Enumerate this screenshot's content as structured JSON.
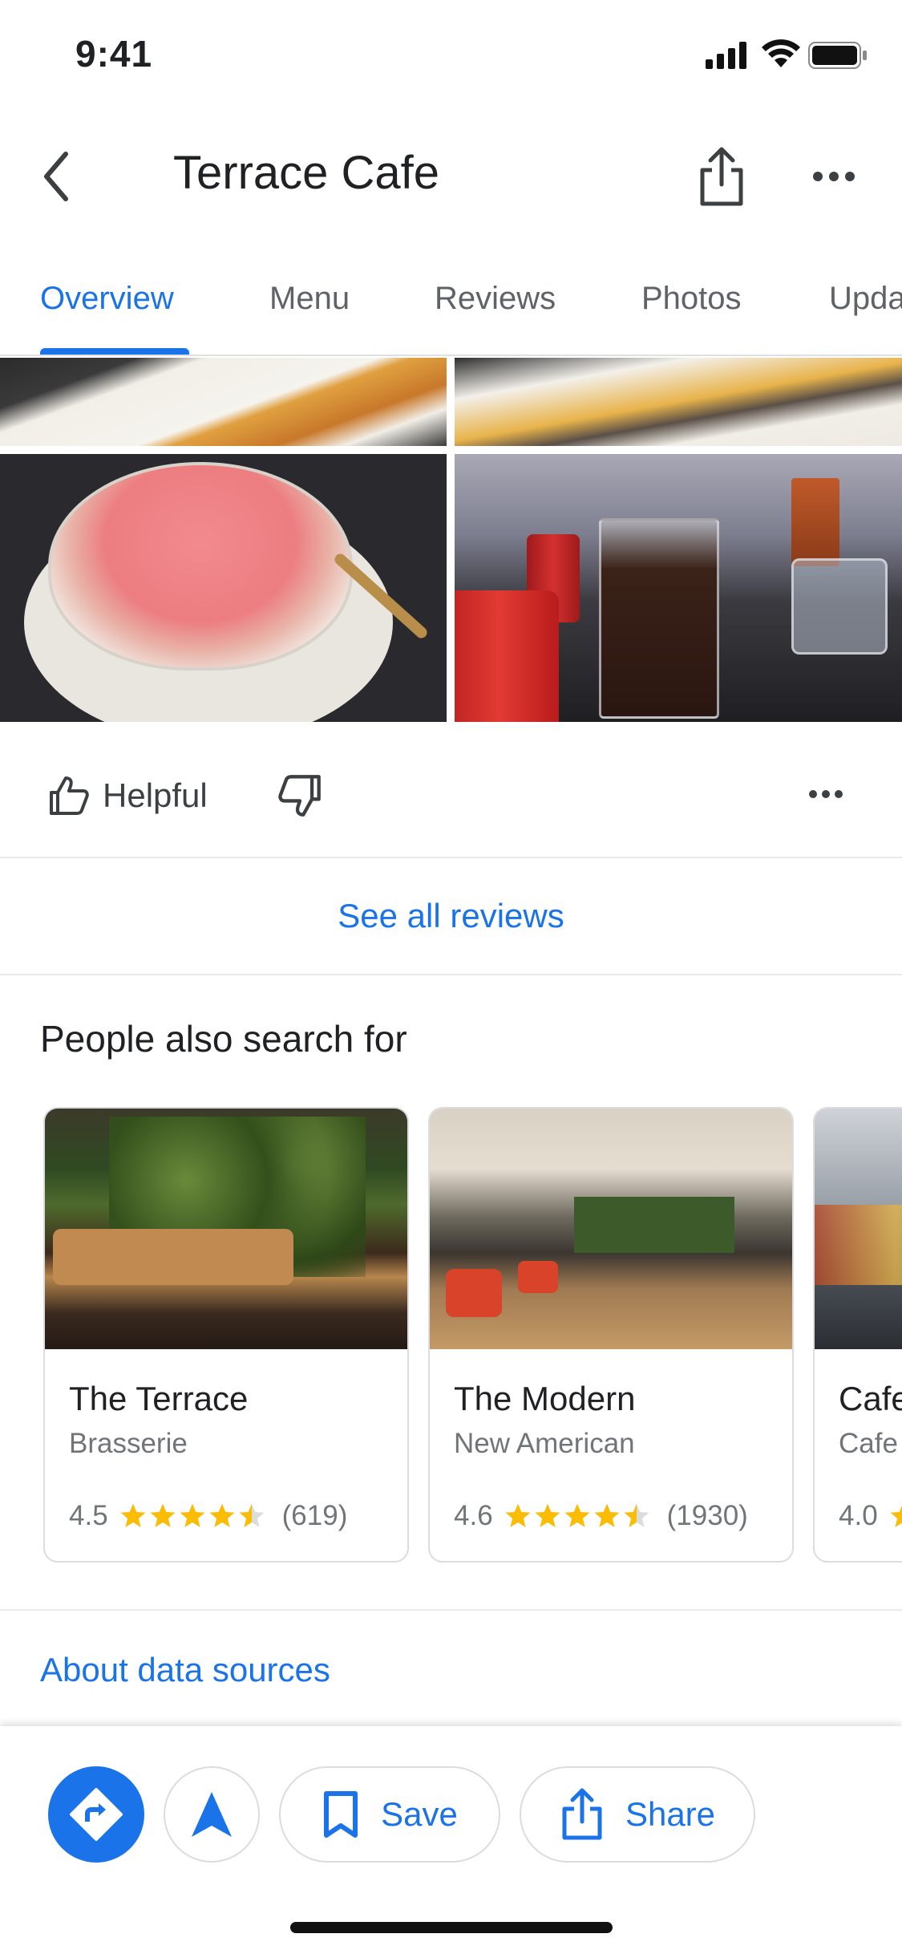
{
  "status_bar": {
    "time": "9:41"
  },
  "header": {
    "title": "Terrace Cafe"
  },
  "tabs": [
    {
      "label": "Overview"
    },
    {
      "label": "Menu"
    },
    {
      "label": "Reviews"
    },
    {
      "label": "Photos"
    },
    {
      "label": "Updates"
    }
  ],
  "review_actions": {
    "helpful_label": "Helpful"
  },
  "see_all_reviews": "See all reviews",
  "people_also_search": {
    "title": "People also search for",
    "places": [
      {
        "name": "The Terrace",
        "category": "Brasserie",
        "rating": "4.5",
        "stars": 4.5,
        "count": "(619)"
      },
      {
        "name": "The Modern",
        "category": "New American",
        "rating": "4.6",
        "stars": 4.5,
        "count": "(1930)"
      },
      {
        "name": "Cafe",
        "category": "Cafe",
        "rating": "4.0",
        "stars": 4.0,
        "count": ""
      }
    ]
  },
  "about_data_sources": "About data sources",
  "bottom_bar": {
    "save_label": "Save",
    "share_label": "Share"
  },
  "colors": {
    "accent": "#1a73e8",
    "star": "#fbbc04",
    "star_empty": "#dadce0"
  },
  "icons": [
    "back-arrow-icon",
    "share-icon",
    "more-icon",
    "thumbs-up-icon",
    "thumbs-down-icon",
    "directions-icon",
    "navigation-icon",
    "bookmark-icon",
    "star-icon"
  ]
}
